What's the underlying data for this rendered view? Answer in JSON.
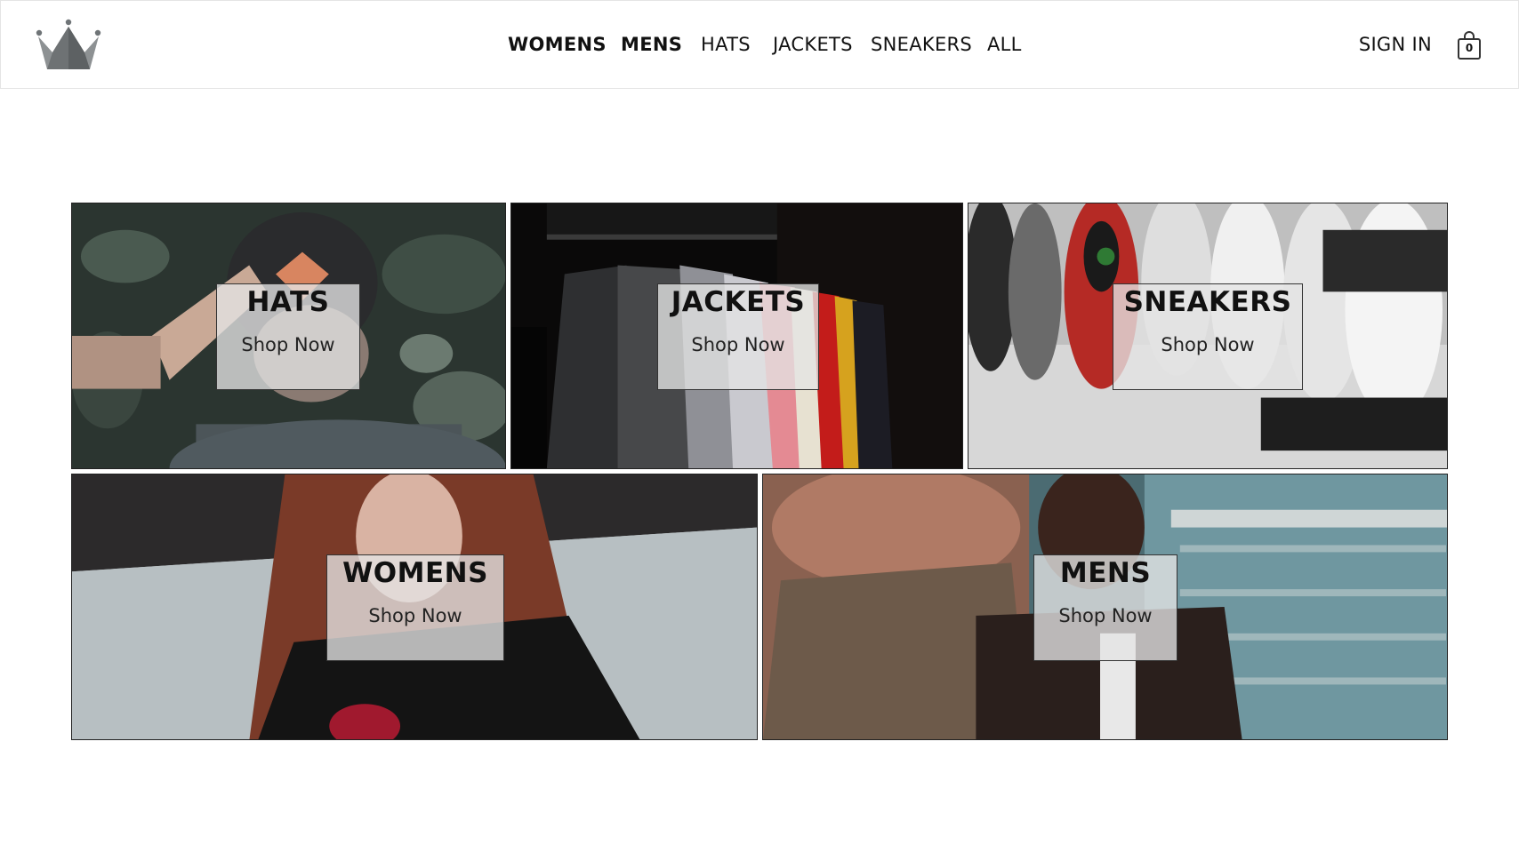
{
  "header": {
    "logo": "crown-logo",
    "nav": [
      "WOMENS",
      "MENS",
      "HATS",
      "JACKETS",
      "SNEAKERS",
      "ALL"
    ],
    "sign_in": "SIGN IN",
    "cart_count": "0",
    "cart_icon": "shopping-bag-icon"
  },
  "categories": [
    {
      "title": "HATS",
      "cta": "Shop Now"
    },
    {
      "title": "JACKETS",
      "cta": "Shop Now"
    },
    {
      "title": "SNEAKERS",
      "cta": "Shop Now"
    },
    {
      "title": "WOMENS",
      "cta": "Shop Now"
    },
    {
      "title": "MENS",
      "cta": "Shop Now"
    }
  ]
}
